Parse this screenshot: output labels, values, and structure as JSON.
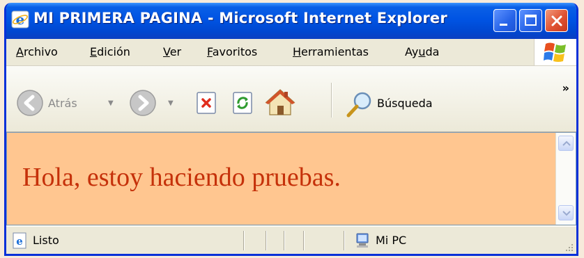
{
  "window": {
    "title": "MI PRIMERA PAGINA - Microsoft Internet Explorer"
  },
  "menu": {
    "items": [
      {
        "first": "A",
        "rest": "rchivo"
      },
      {
        "first": "E",
        "rest": "dición"
      },
      {
        "first": "V",
        "rest": "er"
      },
      {
        "first": "F",
        "rest": "avoritos"
      },
      {
        "first": "H",
        "rest": "erramientas"
      },
      {
        "pre": "Ay",
        "first": "u",
        "rest": "da"
      }
    ]
  },
  "toolbar": {
    "back_label": "Atrás",
    "search_label": "Búsqueda",
    "more": "»"
  },
  "page": {
    "text": "Hola, estoy haciendo pruebas.",
    "background": "#ffc690",
    "text_color": "#c5310a"
  },
  "status": {
    "text": "Listo",
    "zone": "Mi PC"
  }
}
